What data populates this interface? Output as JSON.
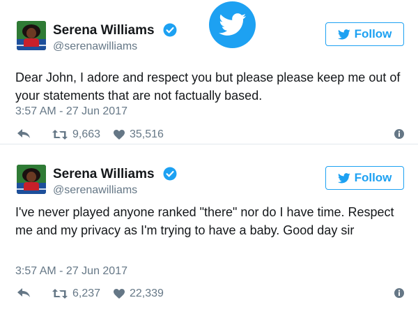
{
  "brand": {
    "logo_icon": "twitter-bird-icon",
    "color": "#1da1f2"
  },
  "tweets": [
    {
      "author_name": "Serena Williams",
      "handle": "@serenawilliams",
      "verified_icon": "verified-badge-icon",
      "follow_label": "Follow",
      "text": "Dear John, I adore and respect you but please please keep me out of your statements that are not factually based.",
      "timestamp": "3:57 AM - 27 Jun 2017",
      "retweets": "9,663",
      "likes": "35,516"
    },
    {
      "author_name": "Serena Williams",
      "handle": "@serenawilliams",
      "verified_icon": "verified-badge-icon",
      "follow_label": "Follow",
      "text": "I've never played anyone ranked \"there\" nor do I have time. Respect me and my privacy as I'm trying to have a baby. Good day sir",
      "timestamp": "3:57 AM - 27 Jun 2017",
      "retweets": "6,237",
      "likes": "22,339"
    }
  ],
  "colors": {
    "text": "#14171a",
    "secondary": "#657786",
    "accent": "#1da1f2",
    "divider": "#e1e8ed"
  }
}
